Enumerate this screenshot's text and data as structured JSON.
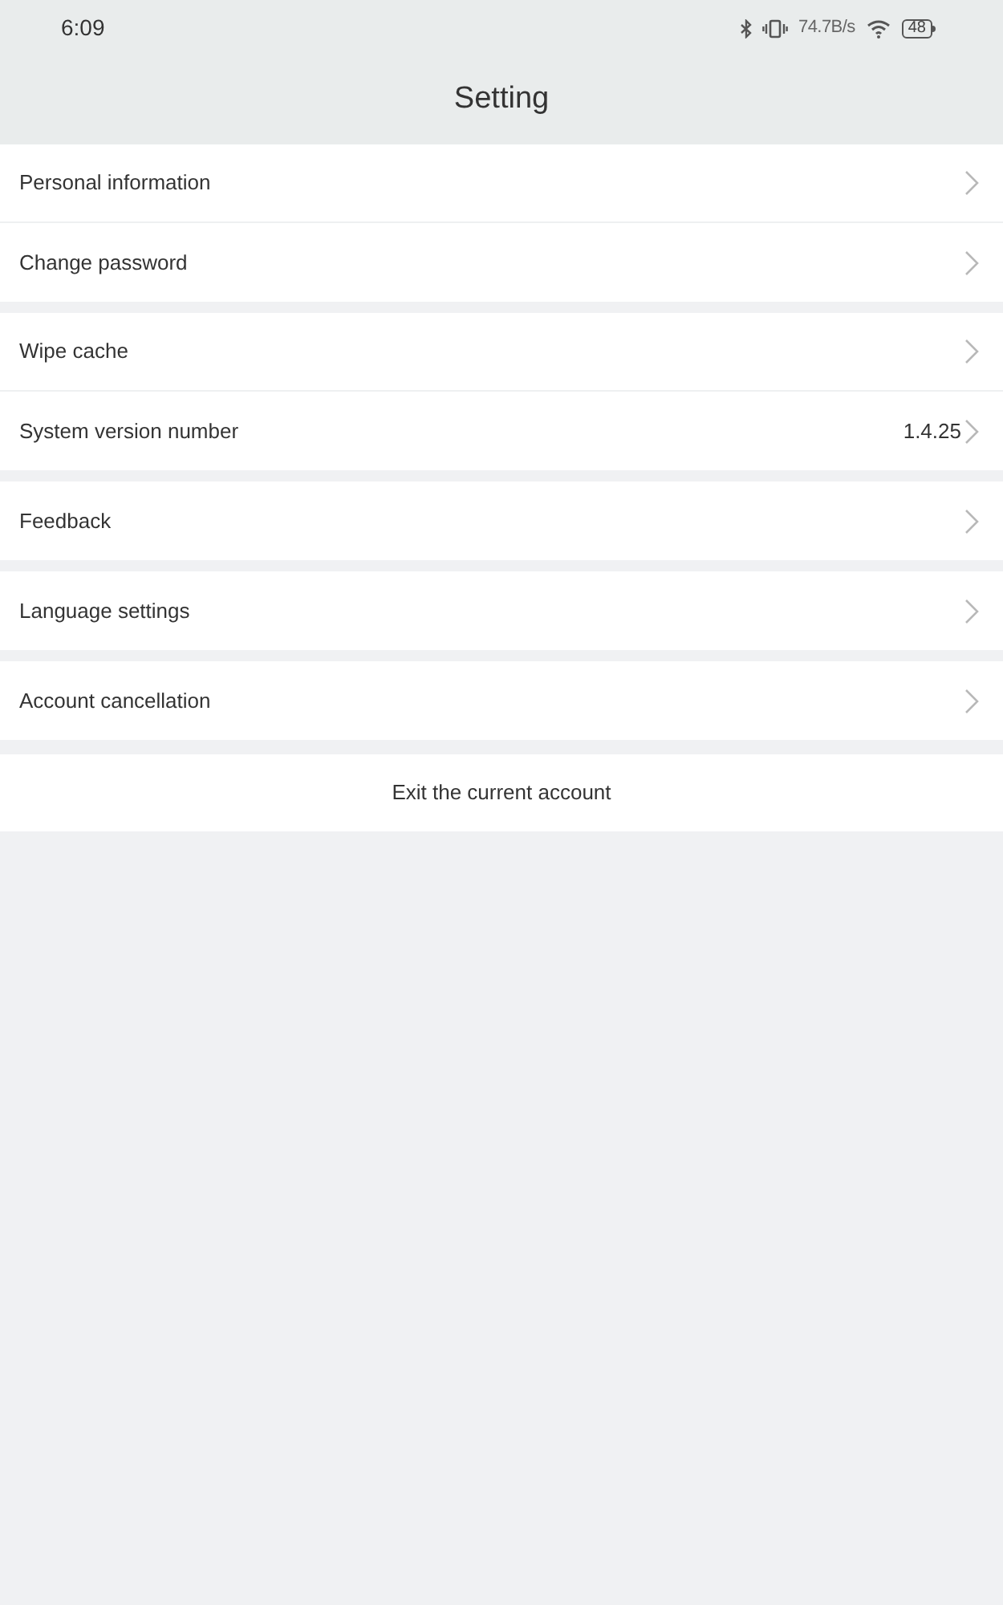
{
  "status_bar": {
    "time": "6:09",
    "network_speed": "74.7B/s",
    "battery": "48"
  },
  "header": {
    "title": "Setting"
  },
  "groups": [
    {
      "items": [
        {
          "label": "Personal information"
        },
        {
          "label": "Change password"
        }
      ]
    },
    {
      "items": [
        {
          "label": "Wipe cache"
        },
        {
          "label": "System version number",
          "value": "1.4.25"
        }
      ]
    },
    {
      "items": [
        {
          "label": "Feedback"
        }
      ]
    },
    {
      "items": [
        {
          "label": "Language settings"
        }
      ]
    },
    {
      "items": [
        {
          "label": "Account cancellation"
        }
      ]
    }
  ],
  "exit_button": {
    "label": "Exit the current account"
  }
}
